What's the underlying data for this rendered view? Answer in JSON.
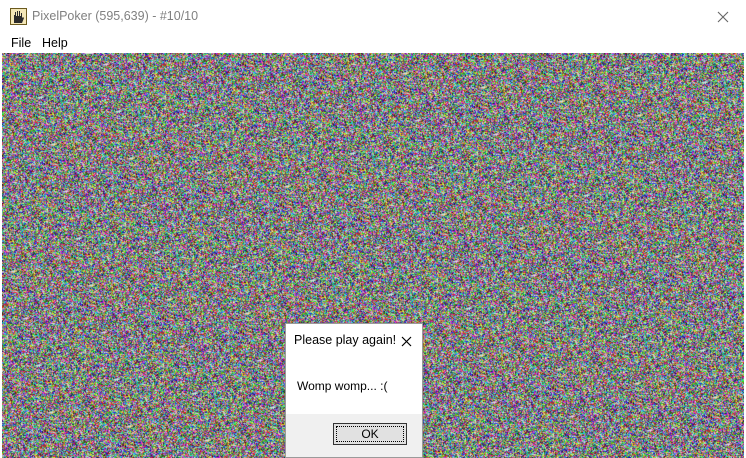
{
  "window": {
    "title": "PixelPoker (595,639) - #10/10",
    "icon": "pixelpoker-hand-icon"
  },
  "menu": {
    "items": [
      "File",
      "Help"
    ]
  },
  "canvas": {
    "content": "random-color-noise"
  },
  "dialog": {
    "title": "Please play again!",
    "message": "Womp womp... :(",
    "ok_label": "OK"
  },
  "colors": {
    "title_text": "#808080",
    "dialog_footer": "#f0f0f0",
    "button_face": "#e1e1e1"
  }
}
